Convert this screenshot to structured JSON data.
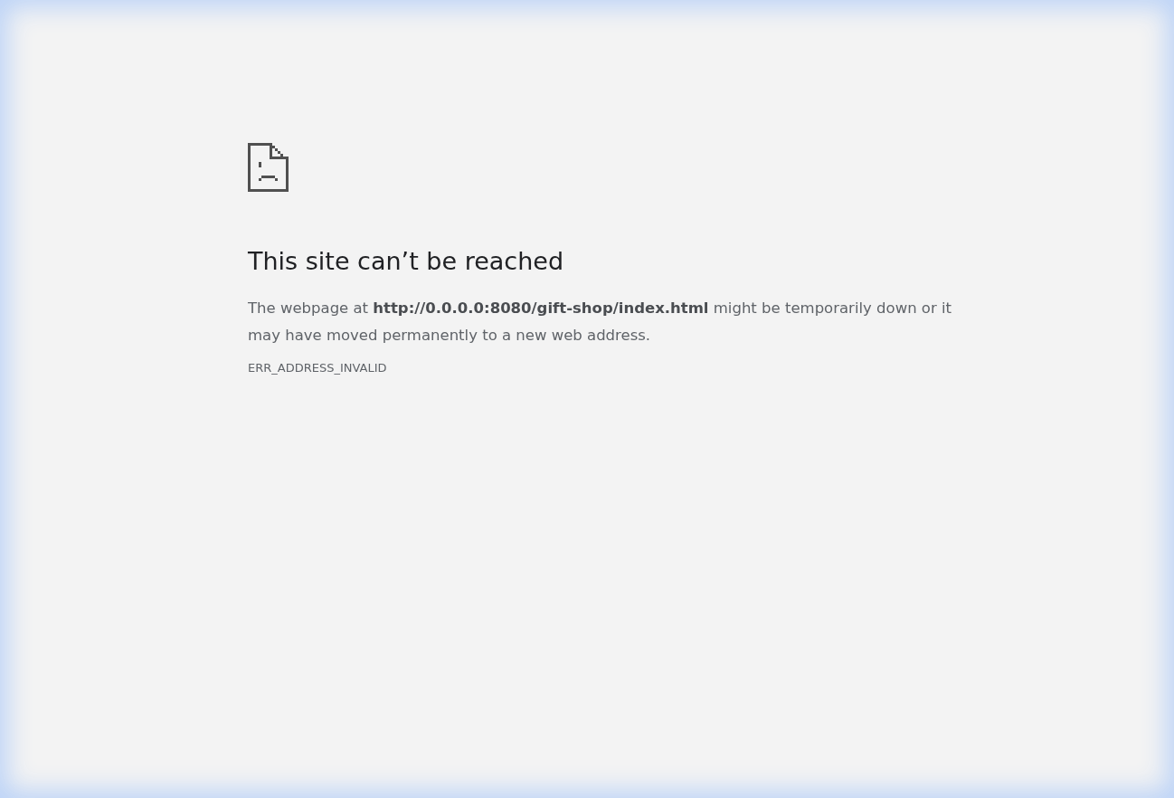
{
  "error_page": {
    "title": "This site can’t be reached",
    "message": "The webpage at **http://0.0.0.0:8080/gift-shop/index.html** might be temporarily down or it may have moved permanently to a new web address.",
    "error_code": "ERR_ADDRESS_INVALID"
  }
}
